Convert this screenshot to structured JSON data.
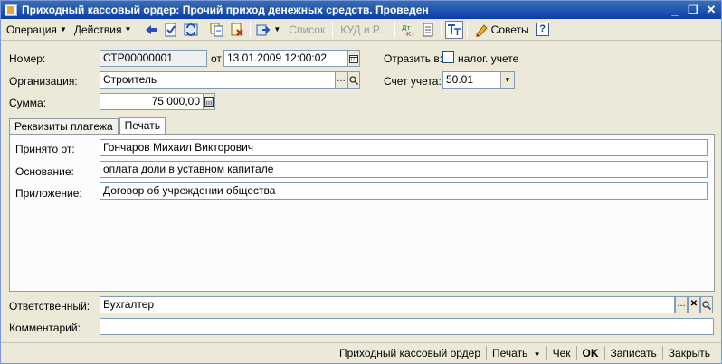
{
  "window": {
    "title": "Приходный кассовый ордер: Прочий приход денежных средств. Проведен",
    "minimize": "_",
    "restore": "❐",
    "close": "✕"
  },
  "toolbar": {
    "operation": "Операция",
    "actions": "Действия",
    "list": "Список",
    "kud": "КУД и Р...",
    "tips": "Советы",
    "help": "?"
  },
  "form": {
    "number_label": "Номер:",
    "number_value": "СТР00000001",
    "date_label": "от:",
    "date_value": "13.01.2009 12:00:02",
    "reflect_label": "Отразить в:",
    "tax_label": "налог. учете",
    "org_label": "Организация:",
    "org_value": "Строитель",
    "account_label": "Счет учета:",
    "account_value": "50.01",
    "sum_label": "Сумма:",
    "sum_value": "75 000,00"
  },
  "tabs": [
    {
      "label": "Реквизиты платежа"
    },
    {
      "label": "Печать"
    }
  ],
  "print": {
    "received_label": "Принято от:",
    "received_value": "Гончаров Михаил Викторович",
    "basis_label": "Основание:",
    "basis_value": "оплата доли в уставном капитале",
    "attachment_label": "Приложение:",
    "attachment_value": "Договор об учреждении общества"
  },
  "footer": {
    "responsible_label": "Ответственный:",
    "responsible_value": "Бухгалтер",
    "comment_label": "Комментарий:",
    "comment_value": ""
  },
  "statusbar": {
    "pko": "Приходный кассовый ордер",
    "print": "Печать",
    "check": "Чек",
    "ok": "OK",
    "save": "Записать",
    "close": "Закрыть"
  }
}
